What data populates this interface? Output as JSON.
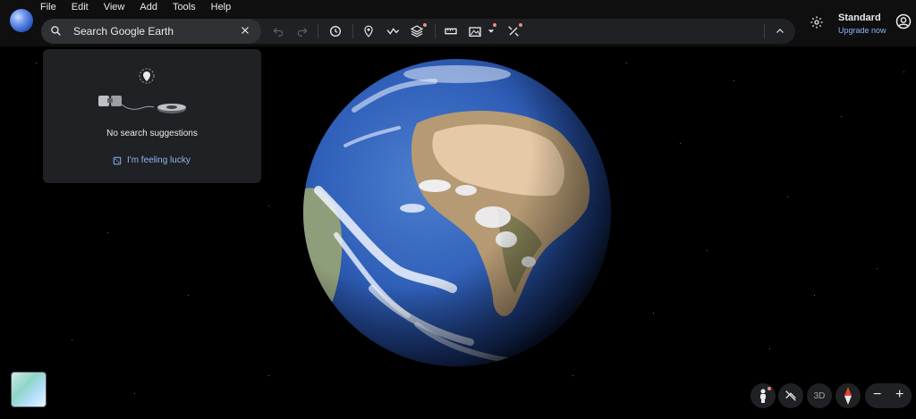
{
  "app": {
    "name": "Google Earth"
  },
  "menu": [
    "File",
    "Edit",
    "View",
    "Add",
    "Tools",
    "Help"
  ],
  "search": {
    "placeholder": "Search Google Earth"
  },
  "toolbar_icons": [
    "undo-icon",
    "redo-icon",
    "history-icon",
    "placemark-icon",
    "path-icon",
    "layers-icon",
    "ruler-icon",
    "map-style-icon",
    "satellite-icon",
    "chevron-up-icon"
  ],
  "account": {
    "plan": "Standard",
    "upgrade": "Upgrade now"
  },
  "suggestions": {
    "empty": "No search suggestions",
    "lucky": "I'm feeling lucky"
  },
  "map_controls": {
    "view_mode": "3D"
  },
  "colors": {
    "accent": "#8ab4f8",
    "toolbar_bg": "#202124",
    "notification_dot": "#f28b82"
  }
}
